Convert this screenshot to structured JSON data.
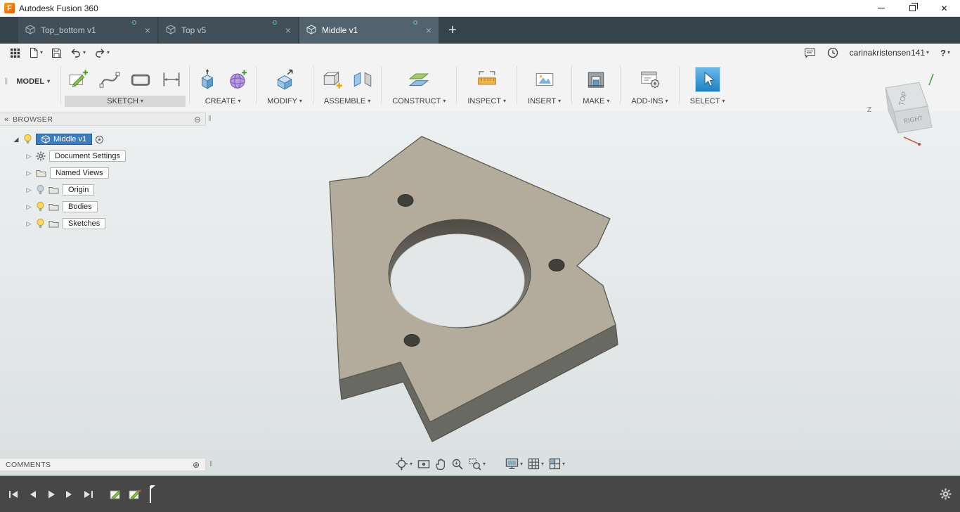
{
  "titlebar": {
    "title": "Autodesk Fusion 360"
  },
  "glyphs": {
    "close": "✕",
    "tab_close": "×",
    "new_tab": "+",
    "caret": "▾",
    "collapse": "«",
    "circle_minus": "⊖",
    "circle_plus": "⊕",
    "grip": "‖",
    "expand_open": "◢",
    "expand_closed": "▷",
    "help": "?"
  },
  "tabs": [
    {
      "label": "Top_bottom v1"
    },
    {
      "label": "Top v5"
    },
    {
      "label": "Middle v1"
    }
  ],
  "qat": {
    "username": "carinakristensen141"
  },
  "ribbon": {
    "workspace": "MODEL",
    "groups": [
      {
        "label": "SKETCH",
        "icons": [
          "create-sketch",
          "fit-point-spline",
          "rectangle",
          "sketch-dimension"
        ]
      },
      {
        "label": "CREATE",
        "icons": [
          "extrude",
          "create-form"
        ]
      },
      {
        "label": "MODIFY",
        "icons": [
          "press-pull"
        ]
      },
      {
        "label": "ASSEMBLE",
        "icons": [
          "new-component",
          "joint"
        ]
      },
      {
        "label": "CONSTRUCT",
        "icons": [
          "construction-plane"
        ]
      },
      {
        "label": "INSPECT",
        "icons": [
          "measure"
        ]
      },
      {
        "label": "INSERT",
        "icons": [
          "insert-canvas"
        ]
      },
      {
        "label": "MAKE",
        "icons": [
          "3d-print"
        ]
      },
      {
        "label": "ADD-INS",
        "icons": [
          "scripts-addins"
        ]
      },
      {
        "label": "SELECT",
        "icons": [
          "select"
        ]
      }
    ]
  },
  "browser": {
    "title": "BROWSER",
    "root": {
      "label": "Middle v1"
    },
    "items": [
      {
        "label": "Document Settings",
        "icon": "gear",
        "bulb": "none"
      },
      {
        "label": "Named Views",
        "icon": "folder",
        "bulb": "none"
      },
      {
        "label": "Origin",
        "icon": "folder",
        "bulb": "off"
      },
      {
        "label": "Bodies",
        "icon": "folder",
        "bulb": "on"
      },
      {
        "label": "Sketches",
        "icon": "folder",
        "bulb": "on"
      }
    ]
  },
  "comments": {
    "title": "COMMENTS"
  },
  "viewcube": {
    "top": "TOP",
    "right": "RIGHT",
    "z_axis": "Z"
  },
  "navbar": {
    "icons": [
      "orbit",
      "look-at",
      "pan",
      "zoom",
      "fit",
      "display-settings",
      "grid-settings",
      "viewports"
    ]
  },
  "timeline": {
    "feature_icons": [
      "sketch-feature",
      "sketch-feature"
    ]
  },
  "colors": {
    "tabbar": "#37434b",
    "accent_select": "#1d83c4",
    "model_top_face": "#b3ac9c",
    "model_side_face": "#696963",
    "timeline_bar": "#474747",
    "selected_chip": "#3e7bbf"
  }
}
